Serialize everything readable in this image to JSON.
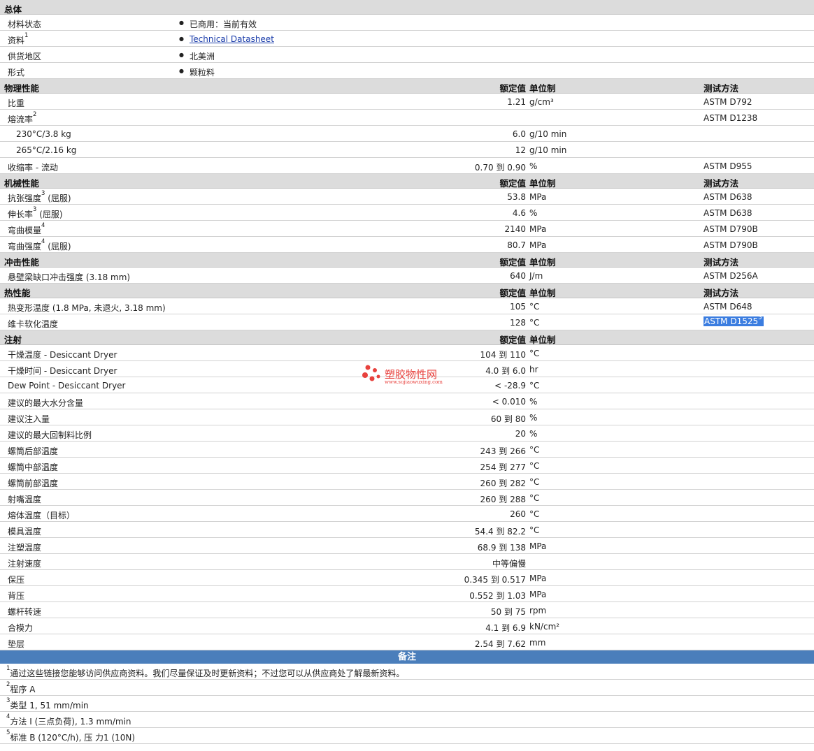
{
  "general": {
    "title": "总体",
    "rows": [
      {
        "name": "材料状态",
        "value": "已商用：当前有效"
      },
      {
        "name": "资料",
        "sup": "1",
        "value": "Technical Datasheet",
        "is_link": true
      },
      {
        "name": "供货地区",
        "value": "北美洲"
      },
      {
        "name": "形式",
        "value": "颗粒料"
      }
    ]
  },
  "sections": [
    {
      "title": "物理性能",
      "h_value": "额定值",
      "h_unit": "单位制",
      "h_method": "测试方法",
      "rows": [
        {
          "name": "比重",
          "value": "1.21",
          "unit": "g/cm³",
          "method": "ASTM D792"
        },
        {
          "name": "熔流率",
          "sup": "2",
          "method": "ASTM D1238"
        },
        {
          "name": "230°C/3.8 kg",
          "sub": true,
          "value": "6.0",
          "unit": "g/10 min"
        },
        {
          "name": "265°C/2.16 kg",
          "sub": true,
          "value": "12",
          "unit": "g/10 min"
        },
        {
          "name": "收缩率  - 流动",
          "value": "0.70 到  0.90",
          "unit": "%",
          "method": "ASTM D955"
        }
      ]
    },
    {
      "title": "机械性能",
      "h_value": "额定值",
      "h_unit": "单位制",
      "h_method": "测试方法",
      "rows": [
        {
          "name": "抗张强度",
          "sup": "3",
          "suffix": " (屈服)",
          "value": "53.8",
          "unit": "MPa",
          "method": "ASTM D638"
        },
        {
          "name": "伸长率",
          "sup": "3",
          "suffix": " (屈服)",
          "value": "4.6",
          "unit": "%",
          "method": "ASTM D638"
        },
        {
          "name": "弯曲模量",
          "sup": "4",
          "value": "2140",
          "unit": "MPa",
          "method": "ASTM D790B"
        },
        {
          "name": "弯曲强度",
          "sup": "4",
          "suffix": " (屈服)",
          "value": "80.7",
          "unit": "MPa",
          "method": "ASTM D790B"
        }
      ]
    },
    {
      "title": "冲击性能",
      "h_value": "额定值",
      "h_unit": "单位制",
      "h_method": "测试方法",
      "rows": [
        {
          "name": "悬壁梁缺口冲击强度  (3.18 mm)",
          "value": "640",
          "unit": "J/m",
          "method": "ASTM D256A"
        }
      ]
    },
    {
      "title": "热性能",
      "h_value": "额定值",
      "h_unit": "单位制",
      "h_method": "测试方法",
      "rows": [
        {
          "name": "热变形温度  (1.8 MPa, 未退火, 3.18 mm)",
          "value": "105",
          "unit": "°C",
          "method": "ASTM D648"
        },
        {
          "name": "维卡软化温度",
          "value": "128",
          "unit": "°C",
          "method": "ASTM D1525",
          "method_sup": "5",
          "highlight": true
        }
      ]
    },
    {
      "title": "注射",
      "h_value": "额定值",
      "h_unit": "单位制",
      "h_method": "",
      "rows": [
        {
          "name": "干燥温度  - Desiccant Dryer",
          "value": "104 到  110",
          "unit": "°C"
        },
        {
          "name": "干燥时间  - Desiccant Dryer",
          "value": "4.0 到  6.0",
          "unit": "hr"
        },
        {
          "name": "Dew Point - Desiccant Dryer",
          "value": "< -28.9",
          "unit": "°C"
        },
        {
          "name": "建议的最大水分含量",
          "value": "< 0.010",
          "unit": "%"
        },
        {
          "name": "建议注入量",
          "value": "60 到  80",
          "unit": "%"
        },
        {
          "name": "建议的最大回制料比例",
          "value": "20",
          "unit": "%"
        },
        {
          "name": "螺筒后部温度",
          "value": "243 到  266",
          "unit": "°C"
        },
        {
          "name": "螺筒中部温度",
          "value": "254 到  277",
          "unit": "°C"
        },
        {
          "name": "螺筒前部温度",
          "value": "260 到  282",
          "unit": "°C"
        },
        {
          "name": "射嘴温度",
          "value": "260 到  288",
          "unit": "°C"
        },
        {
          "name": "熔体温度（目标）",
          "value": "260",
          "unit": "°C"
        },
        {
          "name": "模具温度",
          "value": "54.4 到  82.2",
          "unit": "°C"
        },
        {
          "name": "注塑温度",
          "value": "68.9 到  138",
          "unit": "MPa"
        },
        {
          "name": "注射速度",
          "value": "中等偏慢",
          "unit": ""
        },
        {
          "name": "保压",
          "value": "0.345 到  0.517",
          "unit": "MPa"
        },
        {
          "name": "背压",
          "value": "0.552 到  1.03",
          "unit": "MPa"
        },
        {
          "name": "螺杆转速",
          "value": "50 到  75",
          "unit": "rpm"
        },
        {
          "name": "合模力",
          "value": "4.1 到  6.9",
          "unit": "kN/cm²"
        },
        {
          "name": "垫层",
          "value": "2.54 到  7.62",
          "unit": "mm"
        }
      ]
    }
  ],
  "notes": {
    "title": "备注",
    "items": [
      {
        "sup": "1",
        "text": "通过这些链接您能够访问供应商资料。我们尽量保证及时更新资料；不过您可以从供应商处了解最新资料。"
      },
      {
        "sup": "2",
        "text": "程序  A"
      },
      {
        "sup": "3",
        "text": "类型  1, 51 mm/min"
      },
      {
        "sup": "4",
        "text": "方法  I (三点负荷), 1.3 mm/min"
      },
      {
        "sup": "5",
        "text": "标准  B (120°C/h), 压  力1 (10N)"
      }
    ]
  },
  "watermark": {
    "main": "塑胶物性网",
    "sub": "www.sujiaowuxing.com",
    "color": "#e8413d"
  },
  "colors": {
    "band": "#dcdcdc",
    "notes_band": "#4a7ebb",
    "link": "#1a3caa",
    "highlight": "#3b7de0"
  }
}
